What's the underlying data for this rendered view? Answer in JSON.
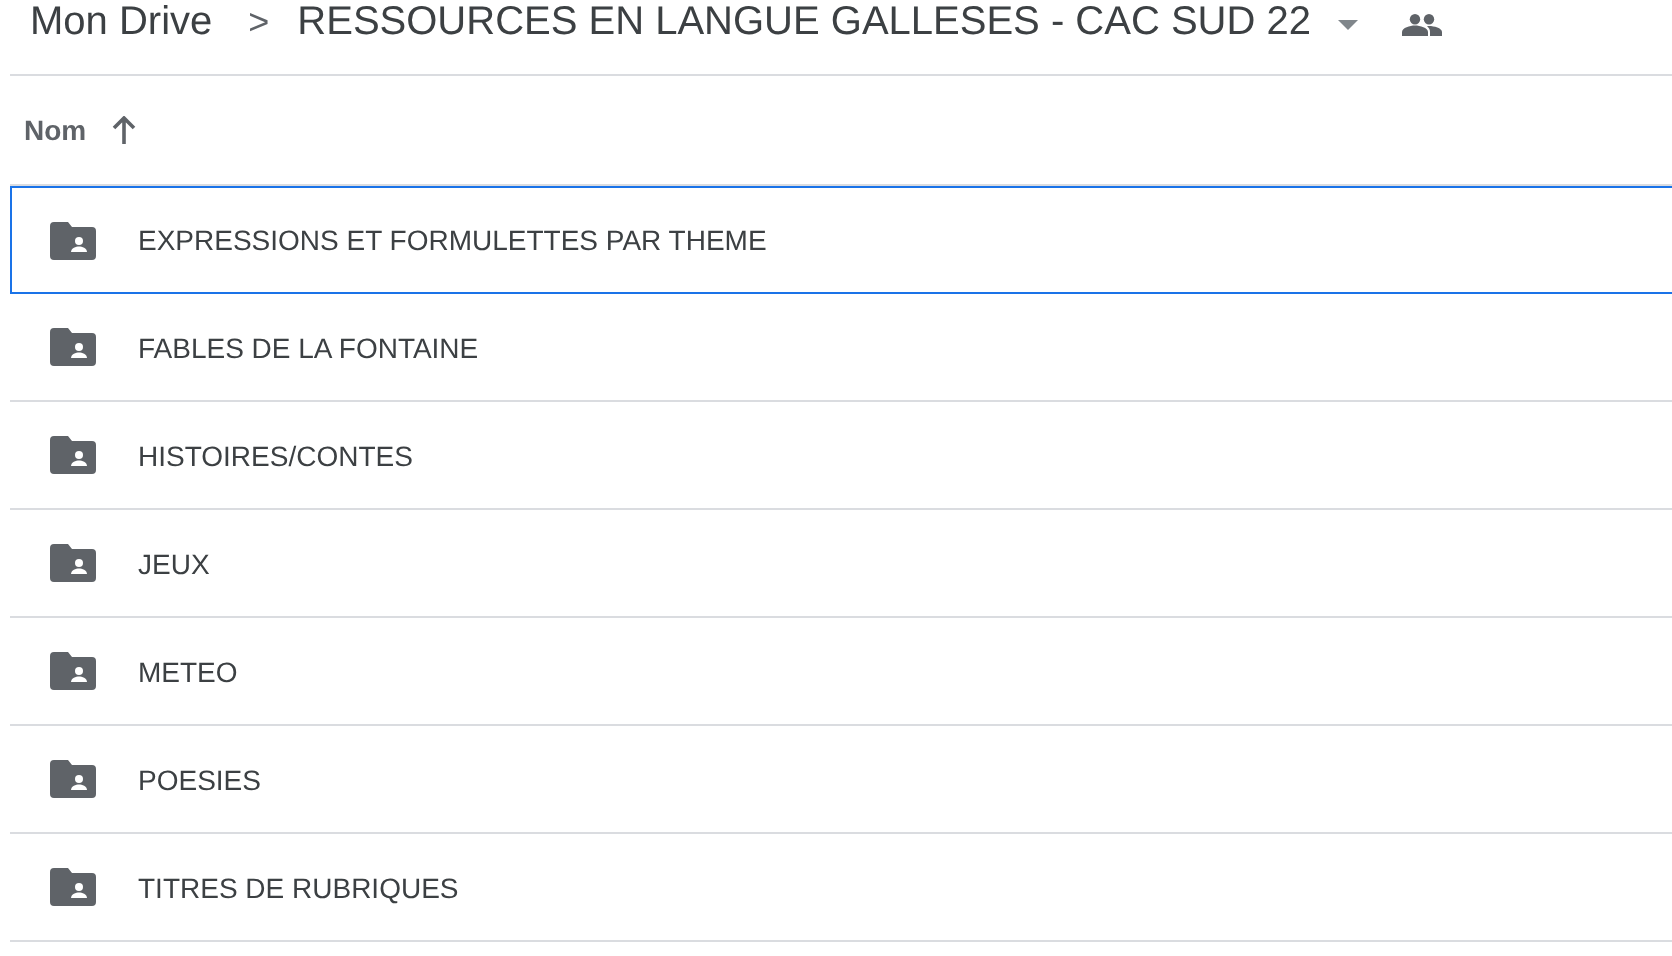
{
  "breadcrumb": {
    "root": "Mon Drive",
    "separator": ">",
    "current": "RESSOURCES EN LANGUE GALLESES - CAC SUD 22"
  },
  "column_header": {
    "label": "Nom",
    "sort_ascending": true
  },
  "rows": [
    {
      "name": "EXPRESSIONS ET FORMULETTES PAR THEME",
      "selected": true
    },
    {
      "name": "FABLES DE LA FONTAINE",
      "selected": false
    },
    {
      "name": "HISTOIRES/CONTES",
      "selected": false
    },
    {
      "name": "JEUX",
      "selected": false
    },
    {
      "name": "METEO",
      "selected": false
    },
    {
      "name": "POESIES",
      "selected": false
    },
    {
      "name": "TITRES DE RUBRIQUES",
      "selected": false
    }
  ]
}
